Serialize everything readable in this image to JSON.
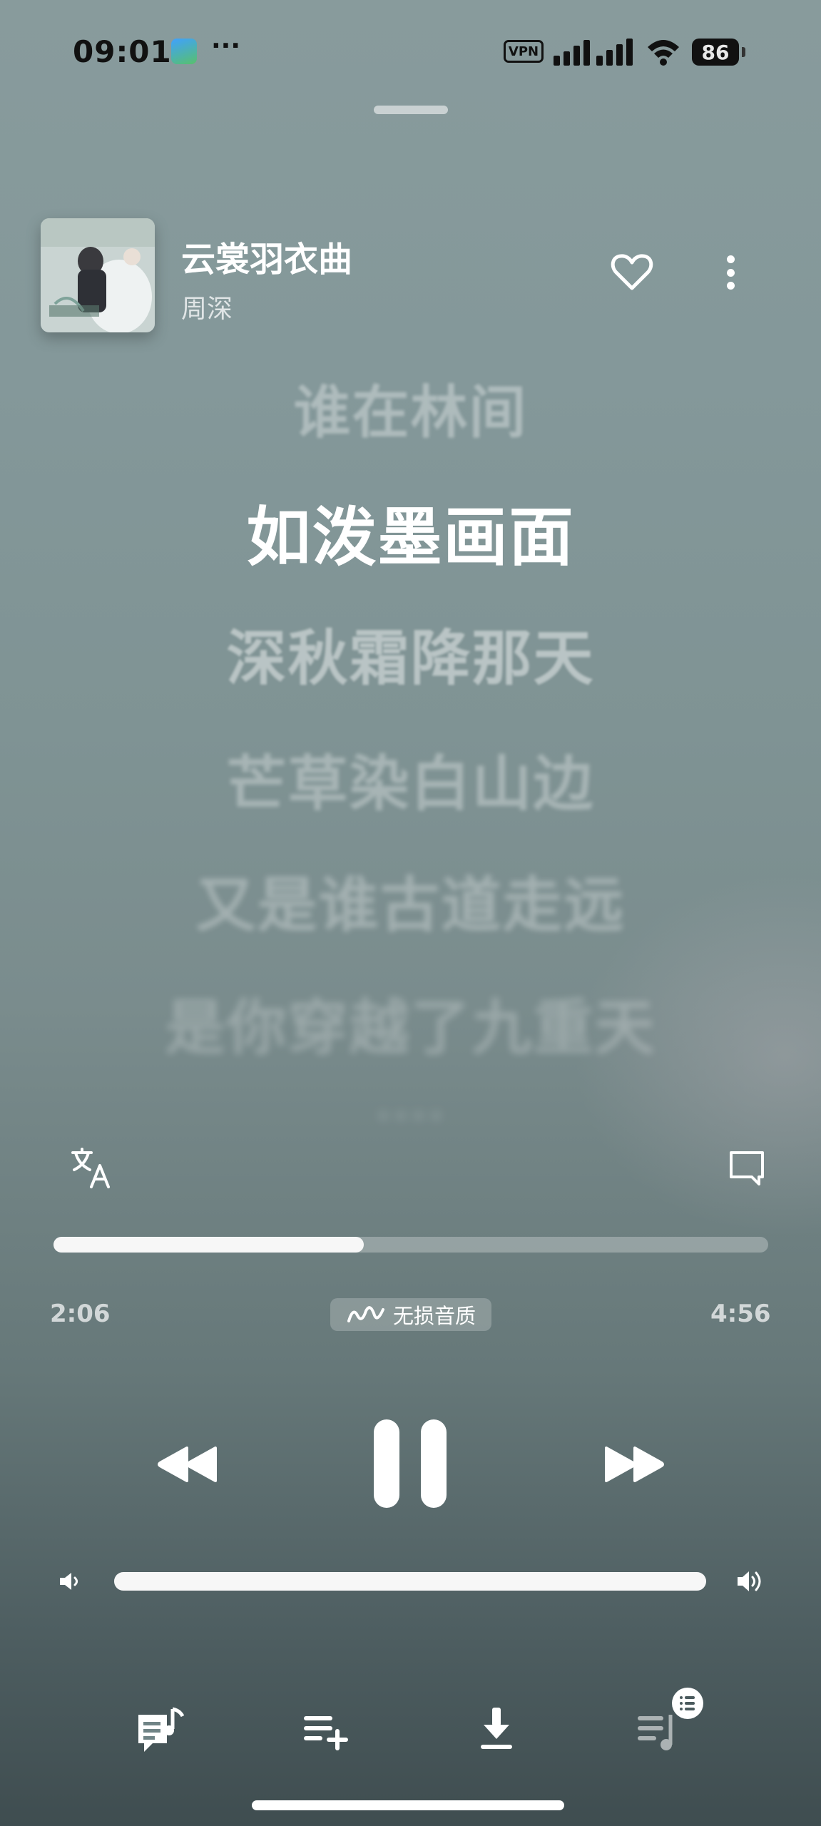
{
  "status_bar": {
    "time": "09:01",
    "more": "···",
    "vpn": "VPN",
    "battery": "86"
  },
  "song": {
    "title": "云裳羽衣曲",
    "artist": "周深"
  },
  "lyrics": [
    "谁在林间",
    "如泼墨画面",
    "深秋霜降那天",
    "芒草染白山边",
    "又是谁古道走远",
    "是你穿越了九重天",
    "····"
  ],
  "player": {
    "current_time": "2:06",
    "total_time": "4:56",
    "progress_fraction": 0.434,
    "quality_label": "无损音质",
    "volume_fraction": 1.0
  },
  "icons": {
    "translate": "translate-icon",
    "comment": "comment-icon",
    "like": "heart-icon",
    "more": "more-vertical-icon",
    "prev": "rewind-icon",
    "pause": "pause-icon",
    "next": "fast-forward-icon",
    "tabs": [
      "lyrics-poster-icon",
      "add-to-playlist-icon",
      "download-icon",
      "queue-icon"
    ]
  }
}
